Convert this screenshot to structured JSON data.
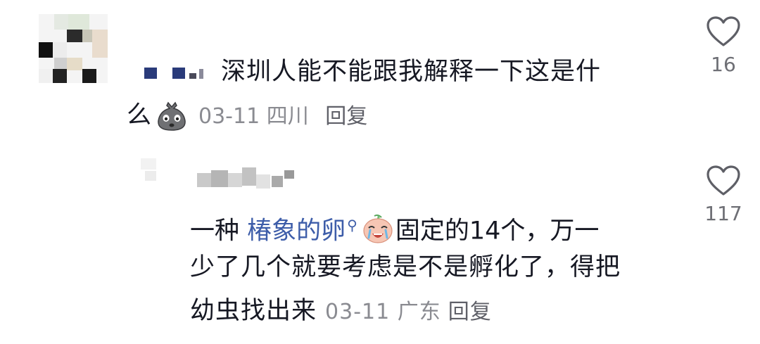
{
  "comments": [
    {
      "text_line1": "深圳人能不能跟我解释一下这是什",
      "text_line2": "么",
      "date": "03-11",
      "location": "四川",
      "reply_label": "回复",
      "likes": "16",
      "emoji_icon": "pouting-bag-emoji-icon"
    },
    {
      "prefix": "一种 ",
      "link_text": "椿象的卵",
      "text_after_emoji": "固定的14个，万一",
      "text_line2": "少了几个就要考虑是不是孵化了，得把",
      "text_line3": "幼虫找出来",
      "date": "03-11",
      "location": "广东",
      "reply_label": "回复",
      "likes": "117",
      "emoji_icon": "crying-face-emoji-icon"
    }
  ],
  "icons": {
    "like": "heart-outline-icon",
    "search": "search-link-icon"
  },
  "colors": {
    "text": "#161823",
    "meta": "#8a8b91",
    "link": "#3d5da9"
  }
}
